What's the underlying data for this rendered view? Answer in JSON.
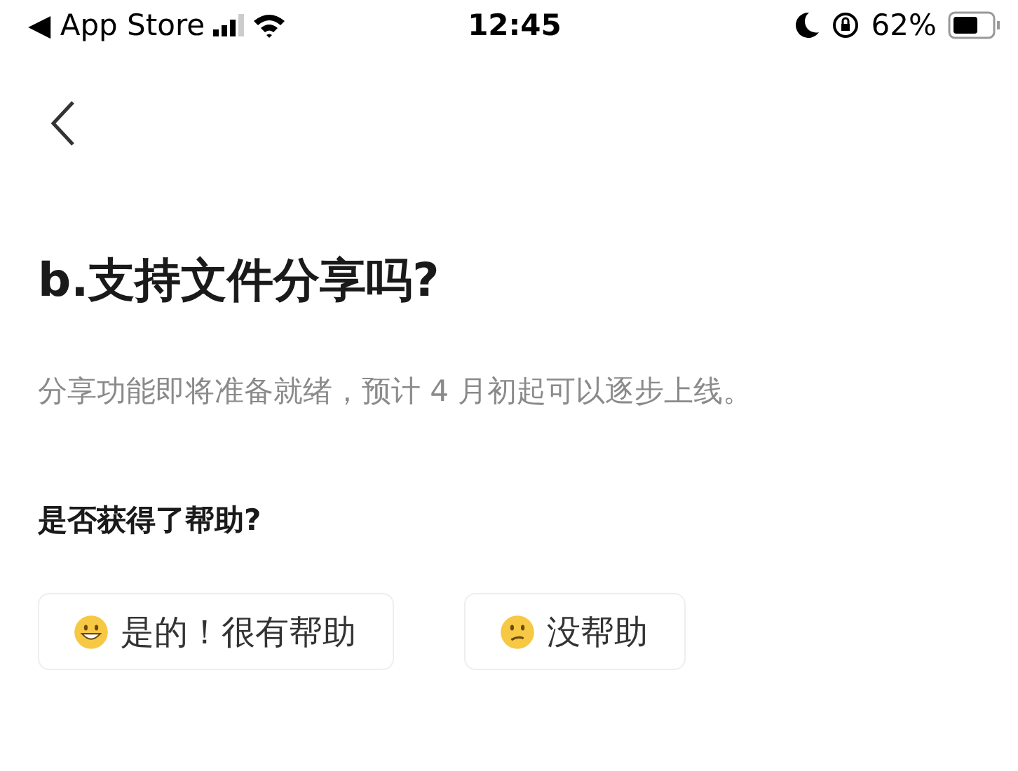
{
  "status_bar": {
    "back_app": "◀ App Store",
    "time": "12:45",
    "battery": "62%"
  },
  "title": "b.支持文件分享吗?",
  "body": "分享功能即将准备就绪，预计 4 月初起可以逐步上线。",
  "question": "是否获得了帮助?",
  "buttons": [
    {
      "kind": "happy",
      "label": "是的！很有帮助"
    },
    {
      "kind": "confused",
      "label": "没帮助"
    }
  ]
}
